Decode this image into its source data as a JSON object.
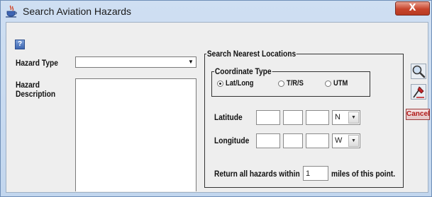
{
  "window": {
    "title": "Search Aviation Hazards",
    "close_glyph": "X"
  },
  "form": {
    "help_glyph": "?",
    "hazard_type_label": "Hazard Type",
    "hazard_type_value": "",
    "hazard_description_label_line1": "Hazard",
    "hazard_description_label_line2": "Description",
    "hazard_description_value": ""
  },
  "search": {
    "group_label": "Search Nearest Locations",
    "coordinate_type_label": "Coordinate Type",
    "options": [
      {
        "label": "Lat/Long",
        "selected": true
      },
      {
        "label": "T/R/S",
        "selected": false
      },
      {
        "label": "UTM",
        "selected": false
      }
    ],
    "latitude_label": "Latitude",
    "latitude_hemisphere": "N",
    "longitude_label": "Longitude",
    "longitude_hemisphere": "W",
    "return_prefix": "Return all hazards within",
    "miles_value": "1",
    "return_suffix": "miles of this point."
  },
  "toolbar": {
    "cancel_label": "Cancel"
  }
}
